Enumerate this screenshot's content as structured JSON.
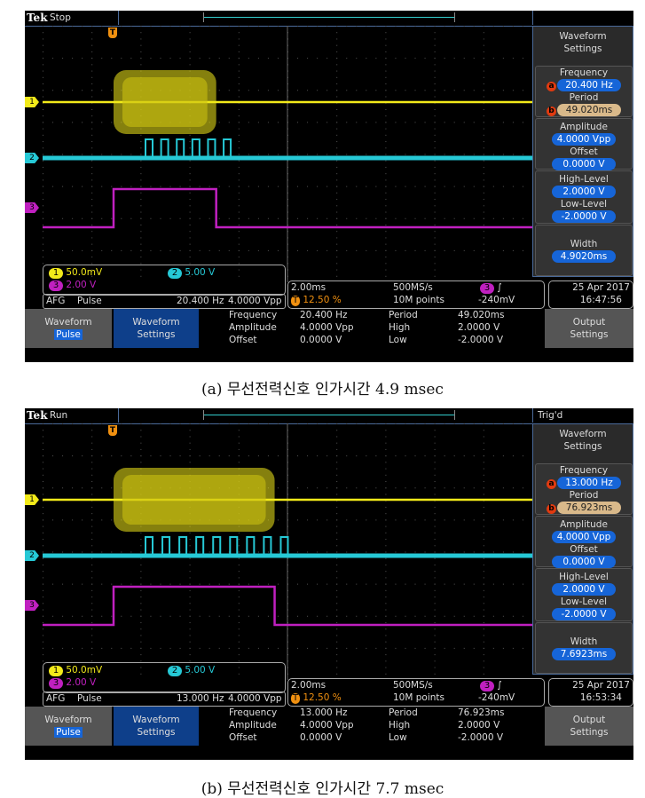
{
  "colors": {
    "ch1": "#f2ea1a",
    "ch2": "#26c9d6",
    "ch3": "#c020c0",
    "accent": "#1665d8",
    "trigger": "#f09010"
  },
  "panels": [
    {
      "caption": "(a) 무선전력신호 인가시간 4.9 msec",
      "brand": "Tek",
      "state": "Stop",
      "trig_status": "",
      "menu": {
        "title1": "Waveform",
        "title2": "Settings",
        "frequency_label": "Frequency",
        "frequency": "20.400 Hz",
        "frequency_badge": "a",
        "period_label": "Period",
        "period": "49.020ms",
        "period_badge": "b",
        "amplitude_label": "Amplitude",
        "amplitude": "4.0000 Vpp",
        "offset_label": "Offset",
        "offset": "0.0000 V",
        "high_label": "High-Level",
        "high": "2.0000 V",
        "low_label": "Low-Level",
        "low": "-2.0000 V",
        "width_label": "Width",
        "width": "4.9020ms"
      },
      "channels": {
        "ch1_num": "1",
        "ch1_scale": "50.0mV",
        "ch2_num": "2",
        "ch2_scale": "5.00 V",
        "ch3_num": "3",
        "ch3_scale": "2.00 V"
      },
      "afg": {
        "label": "AFG",
        "wave": "Pulse",
        "freq": "20.400 Hz",
        "amp": "4.0000 Vpp"
      },
      "horizontal": {
        "timebase": "2.00ms",
        "trig_pos": "12.50 %",
        "sample_rate": "500MS/s",
        "record": "10M points",
        "trig_ch": "3",
        "trig_slope": "∫",
        "trig_level": "-240mV",
        "trig_marker": "T"
      },
      "date": "25 Apr 2017",
      "time": "16:47:56",
      "buttons": {
        "waveform": "Waveform",
        "waveform_value": "Pulse",
        "settings1": "Waveform",
        "settings2": "Settings",
        "output1": "Output",
        "output2": "Settings"
      },
      "summary": {
        "freq_label": "Frequency",
        "freq": "20.400 Hz",
        "amp_label": "Amplitude",
        "amp": "4.0000 Vpp",
        "off_label": "Offset",
        "off": "0.0000 V",
        "period_label": "Period",
        "period": "49.020ms",
        "high_label": "High",
        "high": "2.0000 V",
        "low_label": "Low",
        "low": "-2.0000 V"
      },
      "pulse_width_ms": 4.902
    },
    {
      "caption": "(b) 무선전력신호 인가시간 7.7 msec",
      "brand": "Tek",
      "state": "Run",
      "trig_status": "Trig'd",
      "menu": {
        "title1": "Waveform",
        "title2": "Settings",
        "frequency_label": "Frequency",
        "frequency": "13.000 Hz",
        "frequency_badge": "a",
        "period_label": "Period",
        "period": "76.923ms",
        "period_badge": "b",
        "amplitude_label": "Amplitude",
        "amplitude": "4.0000 Vpp",
        "offset_label": "Offset",
        "offset": "0.0000 V",
        "high_label": "High-Level",
        "high": "2.0000 V",
        "low_label": "Low-Level",
        "low": "-2.0000 V",
        "width_label": "Width",
        "width": "7.6923ms"
      },
      "channels": {
        "ch1_num": "1",
        "ch1_scale": "50.0mV",
        "ch2_num": "2",
        "ch2_scale": "5.00 V",
        "ch3_num": "3",
        "ch3_scale": "2.00 V"
      },
      "afg": {
        "label": "AFG",
        "wave": "Pulse",
        "freq": "13.000 Hz",
        "amp": "4.0000 Vpp"
      },
      "horizontal": {
        "timebase": "2.00ms",
        "trig_pos": "12.50 %",
        "sample_rate": "500MS/s",
        "record": "10M points",
        "trig_ch": "3",
        "trig_slope": "∫",
        "trig_level": "-240mV",
        "trig_marker": "T"
      },
      "date": "25 Apr 2017",
      "time": "16:53:34",
      "buttons": {
        "waveform": "Waveform",
        "waveform_value": "Pulse",
        "settings1": "Waveform",
        "settings2": "Settings",
        "output1": "Output",
        "output2": "Settings"
      },
      "summary": {
        "freq_label": "Frequency",
        "freq": "13.000 Hz",
        "amp_label": "Amplitude",
        "amp": "4.0000 Vpp",
        "off_label": "Offset",
        "off": "0.0000 V",
        "period_label": "Period",
        "period": "76.923ms",
        "high_label": "High",
        "high": "2.0000 V",
        "low_label": "Low",
        "low": "-2.0000 V"
      },
      "pulse_width_ms": 7.6923
    }
  ]
}
